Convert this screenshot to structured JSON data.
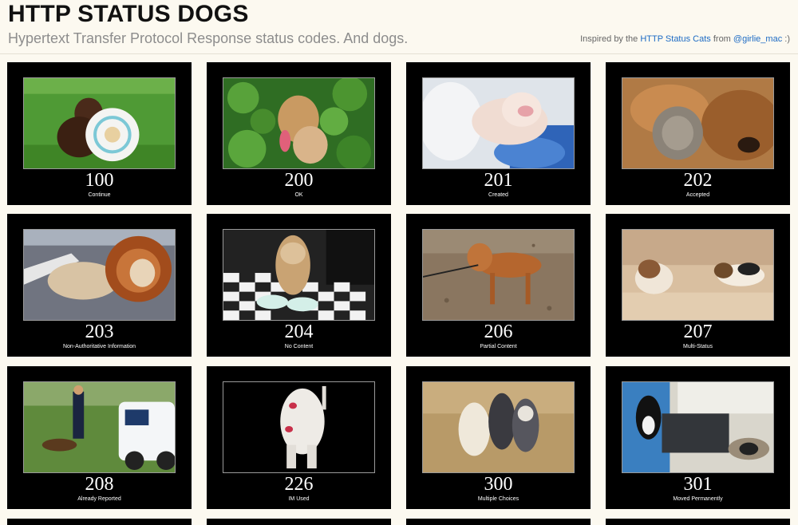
{
  "header": {
    "title": "HTTP STATUS DOGS",
    "subtitle": "Hypertext Transfer Protocol Response status codes. And dogs.",
    "credit_prefix": "Inspired by the",
    "credit_link": "HTTP Status Cats",
    "credit_middle": "from",
    "credit_handle": "@girlie_mac",
    "credit_suffix": ":)"
  },
  "cards": [
    {
      "code": "100",
      "text": "Continue",
      "photo": "chocolate lab puppy holding a white frisbee on grass"
    },
    {
      "code": "200",
      "text": "OK",
      "photo": "small tan dog with tongue out among green leaves"
    },
    {
      "code": "201",
      "text": "Created",
      "photo": "white puppy sleeping on a blue blanket"
    },
    {
      "code": "202",
      "text": "Accepted",
      "photo": "bloodhound cuddling a tabby cat"
    },
    {
      "code": "203",
      "text": "Non-Authoritative Information",
      "photo": "dog wearing a lion mane costume"
    },
    {
      "code": "204",
      "text": "No Content",
      "photo": "dog beside empty bowls on a checkered floor"
    },
    {
      "code": "206",
      "text": "Partial Content",
      "photo": "brown dog on a leash on dirt ground"
    },
    {
      "code": "207",
      "text": "Multi-Status",
      "photo": "two beagle puppies on a couch"
    },
    {
      "code": "208",
      "text": "Already Reported",
      "photo": "police officer with a dog beside a police car"
    },
    {
      "code": "226",
      "text": "IM Used",
      "photo": "white dog from behind with lipstick kiss marks"
    },
    {
      "code": "300",
      "text": "Multiple Choices",
      "photo": "three puppies sitting in dry grass"
    },
    {
      "code": "301",
      "text": "Moved Permanently",
      "photo": "black and white dog on a doorway mat"
    }
  ]
}
